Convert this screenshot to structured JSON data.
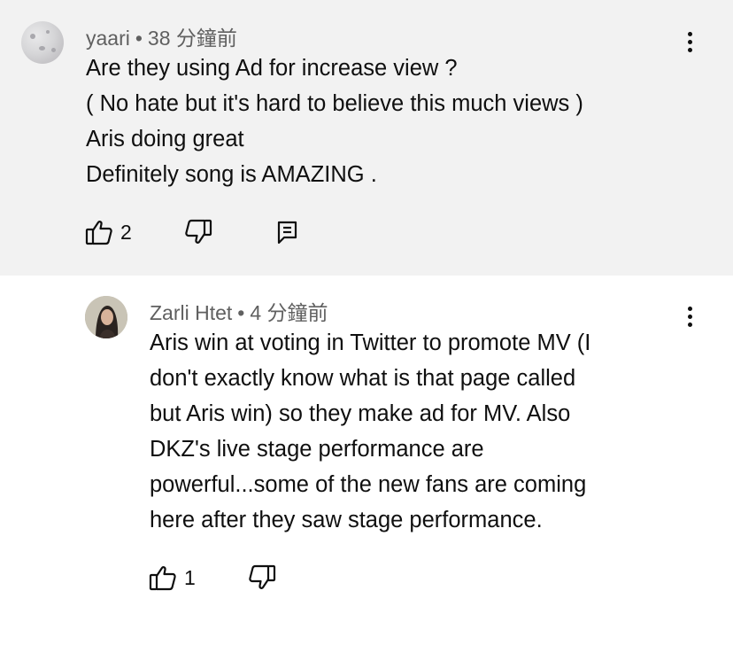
{
  "comment": {
    "author": "yaari",
    "time": "38 分鐘前",
    "lines": [
      "Are they using Ad for increase view ?",
      "( No hate but it's hard to believe this much views )",
      "Aris doing great",
      "Definitely song is AMAZING ."
    ],
    "likes": "2",
    "icons": {
      "like": "thumbs-up-icon",
      "dislike": "thumbs-down-icon",
      "reply": "reply-icon",
      "menu": "more-vert-icon"
    }
  },
  "reply": {
    "author": "Zarli Htet",
    "time": "4 分鐘前",
    "lines": [
      "Aris win at voting in Twitter to promote MV (I",
      "don't exactly know what is that page called",
      "but Aris win) so they make ad for MV. Also",
      "DKZ's live stage performance are",
      "powerful...some of the new fans are coming",
      "here after they saw stage performance."
    ],
    "likes": "1"
  },
  "separator": "•",
  "colors": {
    "top_background": "#f2f2f2",
    "reply_background": "#ffffff",
    "meta_text": "#606060",
    "body_text": "#0f0f0f"
  }
}
